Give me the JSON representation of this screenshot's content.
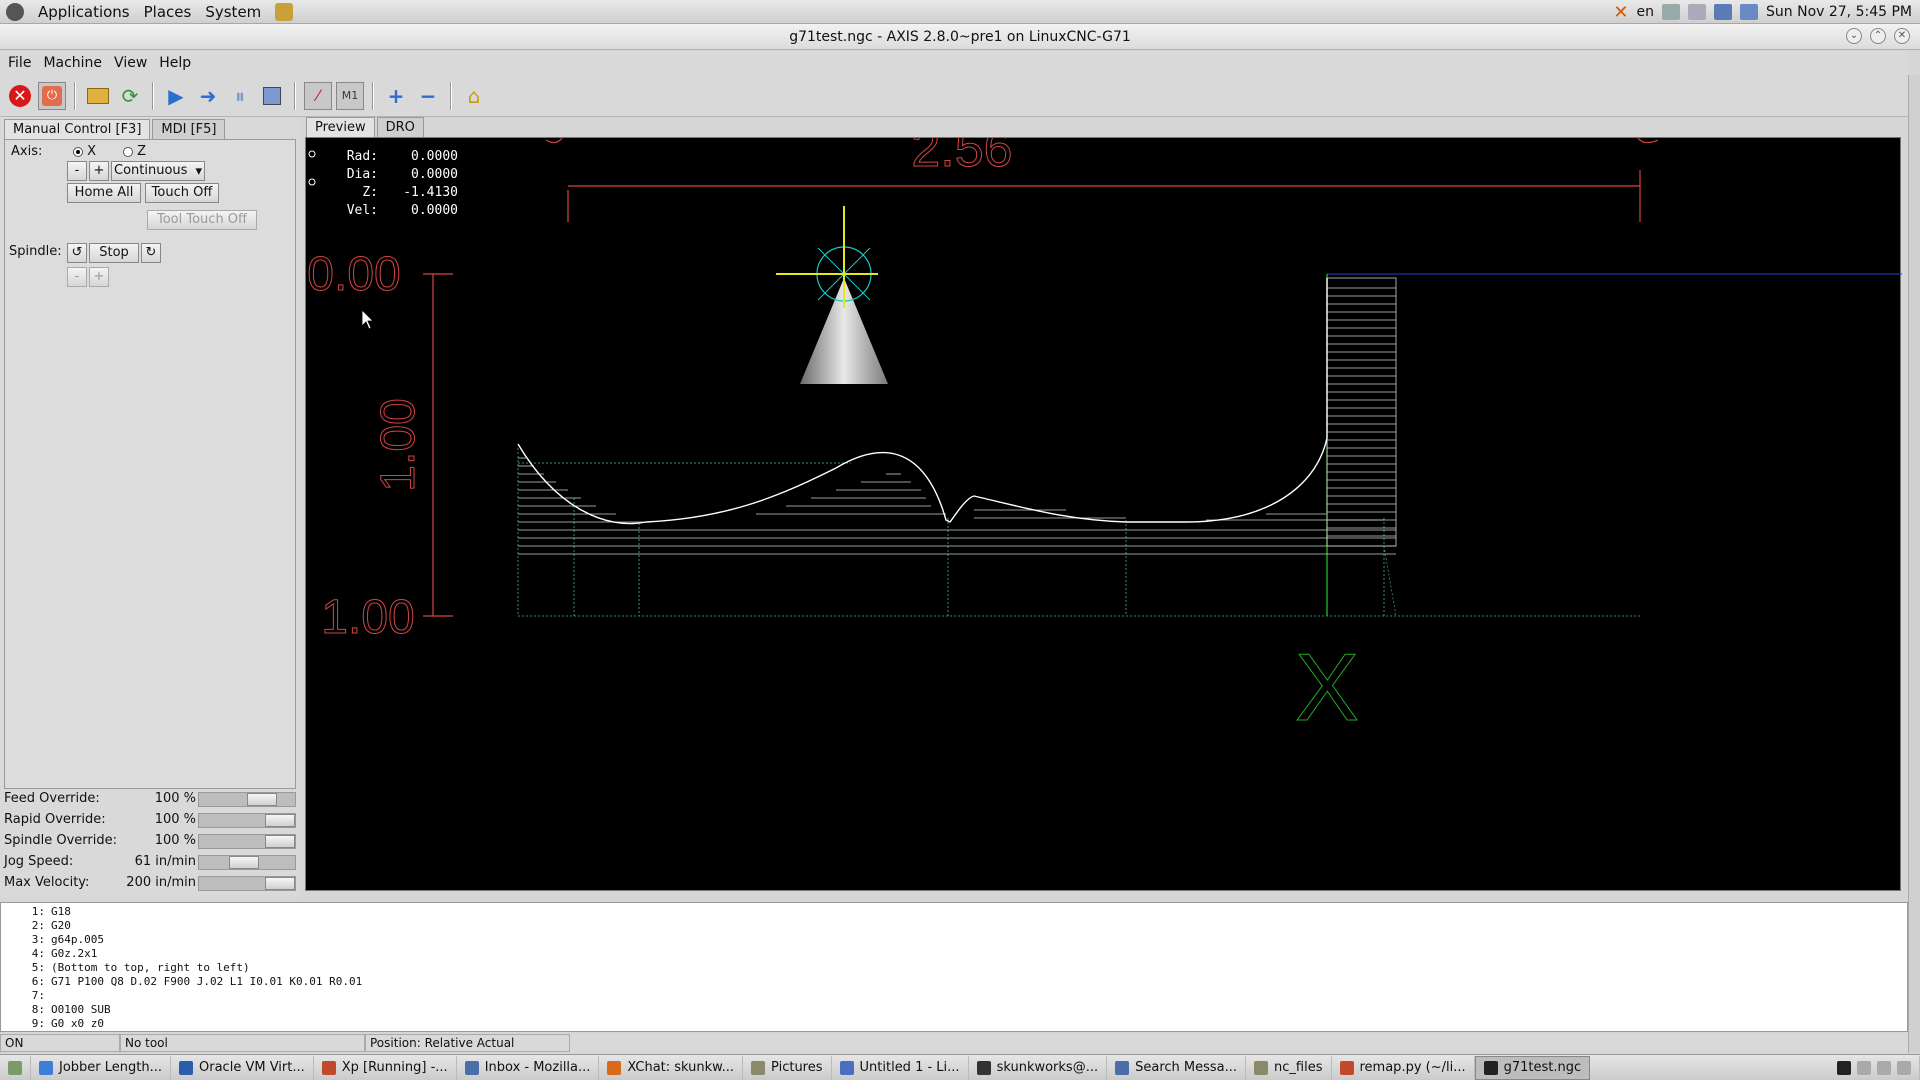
{
  "top_panel": {
    "menus": [
      "Applications",
      "Places",
      "System"
    ],
    "lang": "en",
    "clock": "Sun Nov 27,  5:45 PM"
  },
  "window": {
    "title": "g71test.ngc - AXIS 2.8.0~pre1 on LinuxCNC-G71"
  },
  "menubar": [
    "File",
    "Machine",
    "View",
    "Help"
  ],
  "left_tabs": [
    "Manual Control [F3]",
    "MDI [F5]"
  ],
  "manual": {
    "axis_label": "Axis:",
    "axis_options": [
      "X",
      "Z"
    ],
    "jog_minus": "-",
    "jog_plus": "+",
    "jog_mode": "Continuous",
    "home_all": "Home All",
    "touch_off": "Touch Off",
    "tool_touch_off": "Tool Touch Off",
    "spindle_label": "Spindle:",
    "spindle_stop": "Stop",
    "spindle_minus": "-",
    "spindle_plus": "+"
  },
  "overrides": [
    {
      "label": "Feed Override:",
      "value": "100 %",
      "level": 0.72
    },
    {
      "label": "Rapid Override:",
      "value": "100 %",
      "level": 1.0
    },
    {
      "label": "Spindle Override:",
      "value": "100 %",
      "level": 1.0
    },
    {
      "label": "Jog Speed:",
      "value": "61 in/min",
      "level": 0.45
    },
    {
      "label": "Max Velocity:",
      "value": "200 in/min",
      "level": 1.0
    }
  ],
  "view_tabs": [
    "Preview",
    "DRO"
  ],
  "dro": [
    {
      "label": "Rad:",
      "value": "0.0000"
    },
    {
      "label": "Dia:",
      "value": "0.0000"
    },
    {
      "label": "Z:",
      "value": "-1.4130"
    },
    {
      "label": "Vel:",
      "value": "0.0000"
    }
  ],
  "preview": {
    "dim_width": "2.56",
    "dim_height": "1.00",
    "dim_top": "0.00",
    "dim_bottom": "1.00",
    "axis_mark": "X"
  },
  "code_lines": [
    {
      "n": "1:",
      "t": "G18"
    },
    {
      "n": "2:",
      "t": "G20"
    },
    {
      "n": "3:",
      "t": "g64p.005"
    },
    {
      "n": "4:",
      "t": "G0z.2x1"
    },
    {
      "n": "5:",
      "t": "(Bottom to top, right to left)"
    },
    {
      "n": "6:",
      "t": "G71 P100 Q8 D.02 F900 J.02 L1 I0.01 K0.01 R0.01"
    },
    {
      "n": "7:",
      "t": ""
    },
    {
      "n": "8:",
      "t": "O0100 SUB"
    },
    {
      "n": "9:",
      "t": " G0 x0 z0"
    }
  ],
  "status": {
    "state": "ON",
    "tool": "No tool",
    "position": "Position: Relative Actual"
  },
  "taskbar": [
    {
      "label": "Jobber Length...",
      "color": "#3c7fd6"
    },
    {
      "label": "Oracle VM Virt...",
      "color": "#2a5db0"
    },
    {
      "label": "Xp [Running] -...",
      "color": "#c04a2a"
    },
    {
      "label": "Inbox - Mozilla...",
      "color": "#4a6fa8"
    },
    {
      "label": "XChat: skunkw...",
      "color": "#d86a1a"
    },
    {
      "label": "Pictures",
      "color": "#8a8a6a"
    },
    {
      "label": "Untitled 1 - Li...",
      "color": "#4a6fc0"
    },
    {
      "label": "skunkworks@...",
      "color": "#333333"
    },
    {
      "label": "Search Messa...",
      "color": "#4a6fa8"
    },
    {
      "label": "nc_files",
      "color": "#8a8a6a"
    },
    {
      "label": "remap.py (~/li...",
      "color": "#c04a2a"
    },
    {
      "label": "g71test.ngc",
      "color": "#222222"
    }
  ]
}
